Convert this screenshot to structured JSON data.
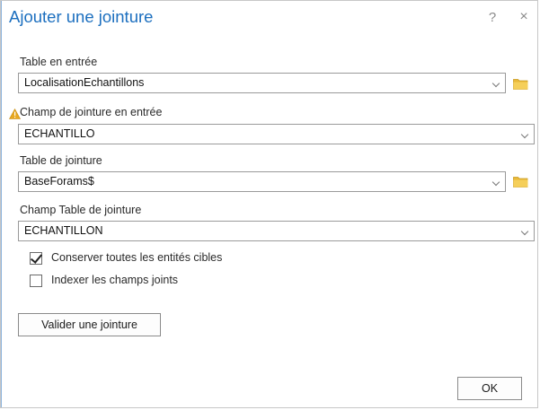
{
  "dialog": {
    "title": "Ajouter une jointure",
    "help_label": "?",
    "close_label": "×"
  },
  "fields": {
    "input_table": {
      "label": "Table en entrée",
      "value": "LocalisationEchantillons"
    },
    "input_join_field": {
      "label": "Champ de jointure en entrée",
      "value": "ECHANTILLO",
      "warning": true
    },
    "join_table": {
      "label": "Table de jointure",
      "value": "BaseForams$"
    },
    "join_table_field": {
      "label": "Champ Table de jointure",
      "value": "ECHANTILLON"
    }
  },
  "options": {
    "keep_all": {
      "label": "Conserver toutes les entités cibles",
      "checked": true
    },
    "index_fields": {
      "label": "Indexer les champs joints",
      "checked": false
    }
  },
  "buttons": {
    "validate": "Valider une jointure",
    "ok": "OK"
  },
  "colors": {
    "title": "#1c6fbf",
    "folder": "#e9b93a",
    "warning": "#e8a820"
  }
}
